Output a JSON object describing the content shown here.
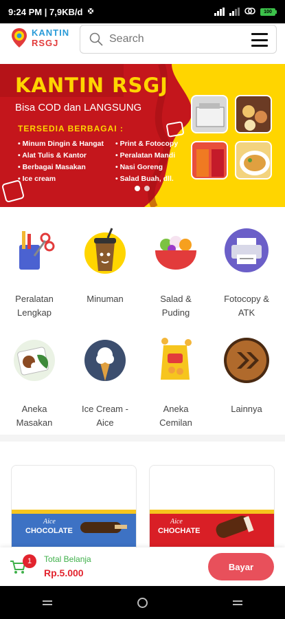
{
  "status": {
    "time_speed": "9:24 PM | 7,9KB/d",
    "battery": "100"
  },
  "header": {
    "logo_line1": "KANTIN",
    "logo_line2": "RSGJ",
    "search_placeholder": "Search"
  },
  "banner": {
    "title": "KANTIN RSGJ",
    "subtitle": "Bisa COD dan LANGSUNG",
    "available": "TERSEDIA BERBAGAI :",
    "items_col1": [
      "Minum Dingin & Hangat",
      "Alat Tulis & Kantor",
      "Berbagai Masakan",
      "Ice cream"
    ],
    "items_col2": [
      "Print & Fotocopy",
      "Peralatan Mandi",
      "Nasi Goreng",
      "Salad Buah, dll."
    ],
    "dots_active": 0
  },
  "categories": [
    {
      "label": "Peralatan Lengkap",
      "icon": "stationery-icon"
    },
    {
      "label": "Minuman",
      "icon": "drink-cup-icon"
    },
    {
      "label": "Salad & Puding",
      "icon": "salad-bowl-icon"
    },
    {
      "label": "Fotocopy & ATK",
      "icon": "printer-icon"
    },
    {
      "label": "Aneka Masakan",
      "icon": "food-plate-icon"
    },
    {
      "label": "Ice Cream - Aice",
      "icon": "ice-cream-icon"
    },
    {
      "label": "Aneka Cemilan",
      "icon": "snack-bag-icon"
    },
    {
      "label": "Lainnya",
      "icon": "more-chevron-icon"
    }
  ],
  "products": [
    {
      "brand": "Aice",
      "name": "CHOCOLATE",
      "color": "#3d72c4"
    },
    {
      "brand": "Aice",
      "name": "CHOCHATE",
      "color": "#d91f26"
    }
  ],
  "cart": {
    "count": "1",
    "total_label": "Total Belanja",
    "total_value": "Rp.5.000",
    "pay_label": "Bayar"
  },
  "colors": {
    "accent": "#e8505b",
    "banner_red": "#c4161c",
    "banner_yellow": "#ffd500",
    "green": "#3fb04a"
  }
}
